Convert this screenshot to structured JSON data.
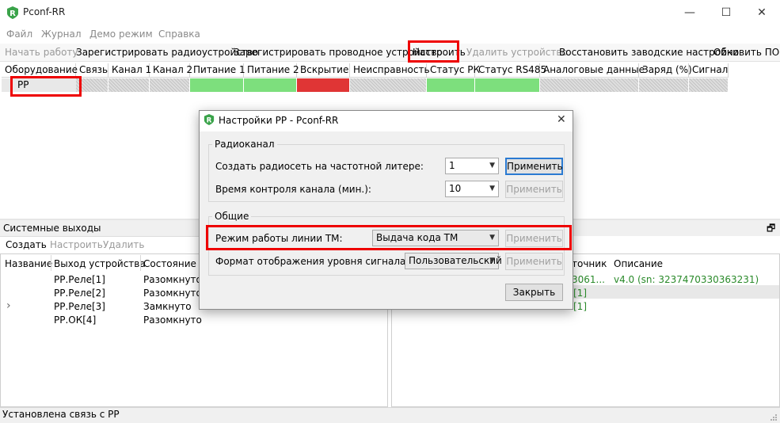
{
  "window": {
    "title": "Pconf-RR",
    "minimize": "—",
    "maximize": "☐",
    "close": "✕"
  },
  "menu": [
    "Файл",
    "Журнал",
    "Демо режим",
    "Справка"
  ],
  "toolbar": {
    "start": "Начать работу",
    "reg_radio": "Зарегистрировать радиоустройство",
    "reg_wired": "Зарегистрировать проводное устройство",
    "configure": "Настроить",
    "delete": "Удалить устройство",
    "restore": "Восстановить заводские настройки",
    "update": "Обновить ПО"
  },
  "device_table": {
    "columns": [
      "Оборудование",
      "Связь",
      "Канал 1",
      "Канал 2",
      "Питание 1",
      "Питание 2",
      "Вскрытие",
      "Неисправность",
      "Статус РК",
      "Статус RS485",
      "Аналоговые данные",
      "Заряд (%)",
      "Сигнал"
    ],
    "row": {
      "device": "РР",
      "states": [
        "gray",
        "gray",
        "gray",
        "green",
        "green",
        "red",
        "gray",
        "green",
        "green",
        "gray",
        "gray",
        "gray"
      ]
    }
  },
  "colors": {
    "green": "#7ddf7d",
    "red": "#e03535",
    "gray": "#d0d0d0",
    "highlight": "#e00000",
    "accent": "#2a7ad2"
  },
  "system_outputs": {
    "title": "Системные выходы",
    "actions": {
      "create": "Создать",
      "configure": "Настроить",
      "delete": "Удалить"
    },
    "columns": [
      "Название",
      "Выход устройства",
      "Состояние"
    ],
    "rows": [
      {
        "output": "РР.Реле[1]",
        "state": "Разомкнуто"
      },
      {
        "output": "РР.Реле[2]",
        "state": "Разомкнуто"
      },
      {
        "output": "РР.Реле[3]",
        "state": "Замкнуто"
      },
      {
        "output": "РР.ОК[4]",
        "state": "Разомкнуто"
      }
    ],
    "expand": "›"
  },
  "right_panel": {
    "columns": [
      "точник",
      "Описание"
    ],
    "rows": [
      {
        "source": "3061...",
        "description": "v4.0 (sn: 3237470330363231)"
      },
      {
        "source": "[1]",
        "description": ""
      },
      {
        "source": "[1]",
        "description": ""
      }
    ],
    "pin_icon": "🗗"
  },
  "status": "Установлена связь с РР",
  "dialog": {
    "title": "Настройки РР - Pconf-RR",
    "close": "✕",
    "group_radio": {
      "label": "Радиоканал",
      "row1": {
        "label": "Создать радиосеть на частотной литере:",
        "value": "1",
        "button": "Применить"
      },
      "row2": {
        "label": "Время контроля канала (мин.):",
        "value": "10",
        "button": "Применить"
      }
    },
    "group_common": {
      "label": "Общие",
      "row1": {
        "label": "Режим работы линии ТМ:",
        "value": "Выдача кода ТМ",
        "button": "Применить"
      },
      "row2": {
        "label": "Формат отображения уровня сигнала:",
        "value": "Пользовательский",
        "button": "Применить"
      }
    },
    "close_button": "Закрыть"
  }
}
